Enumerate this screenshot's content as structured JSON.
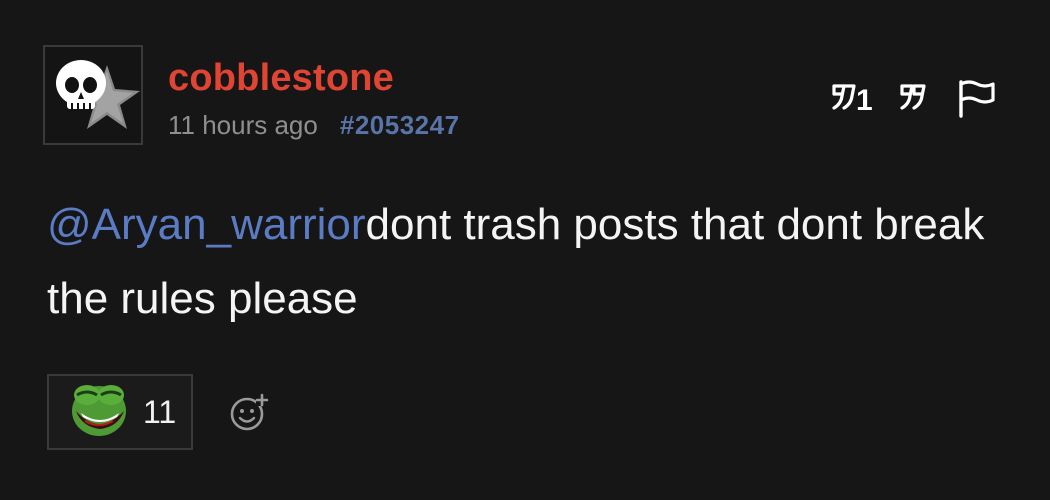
{
  "post": {
    "username": "cobblestone",
    "timestamp": "11 hours ago",
    "post_id": "#2053247",
    "mention": "@Aryan_warrior",
    "body_text": "dont trash posts that dont break the rules please",
    "reply_number": "1"
  },
  "reaction": {
    "emote": "laughing-frog-emote",
    "count": "11"
  },
  "icons": {
    "avatar": "skull-star-avatar",
    "reply": "reply-quote-icon",
    "quote": "quote-icon",
    "flag": "flag-icon",
    "add_reaction": "add-reaction-icon"
  },
  "colors": {
    "background": "#161616",
    "username": "#e04432",
    "mention": "#5b7cc4",
    "post_id": "#5874a8",
    "timestamp": "#8f8f8f"
  }
}
